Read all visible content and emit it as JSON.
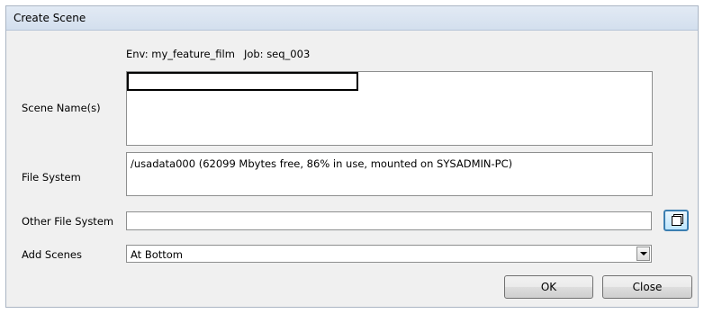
{
  "window": {
    "title": "Create Scene"
  },
  "env": {
    "env_text": "Env: my_feature_film",
    "job_text": "Job: seq_003"
  },
  "labels": {
    "scene_names": "Scene Name(s)",
    "file_system": "File System",
    "other_file_system": "Other File System",
    "add_scenes": "Add Scenes"
  },
  "scene_names": {
    "value": ""
  },
  "file_system": {
    "entry": "/usadata000  (62099 Mbytes free, 86% in use, mounted on SYSADMIN-PC)"
  },
  "other_file_system": {
    "value": ""
  },
  "add_scenes": {
    "selected": "At Bottom"
  },
  "buttons": {
    "ok": "OK",
    "close": "Close"
  },
  "icons": {
    "browse": "browse-icon",
    "dropdown": "chevron-down-icon"
  },
  "colors": {
    "dialog_bg": "#f0f0f0",
    "title_bar": "#d9e4f1",
    "browse_border": "#3c7fb1"
  }
}
